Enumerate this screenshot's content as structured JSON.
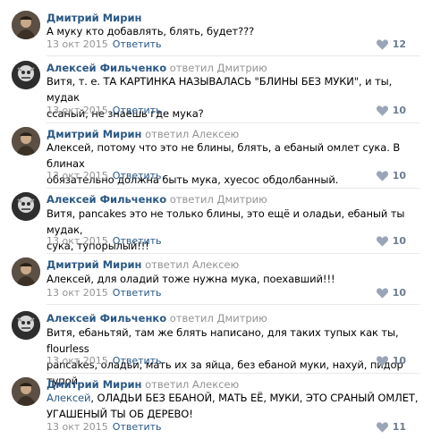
{
  "comments": [
    {
      "author": "Дмитрий Мирин",
      "reply_label": "",
      "reply_target": "",
      "mention": "",
      "text_lines": [
        "А муку кто добавлять, блять, будет???"
      ],
      "date": "13 окт 2015",
      "reply_link": "Ответить",
      "likes": "12",
      "avatar_icon": "dmitry-avatar"
    },
    {
      "author": "Алексей Фильченко",
      "reply_label": "ответил",
      "reply_target": "Дмитрию",
      "mention": "",
      "text_lines": [
        "Витя, т. е. ТА КАРТИНКА НАЗЫВАЛАСЬ \"БЛИНЫ БЕЗ МУКИ\", и ты, мудак",
        "ссаный, не знаешь где мука?"
      ],
      "date": "13 окт 2015",
      "reply_link": "Ответить",
      "likes": "10",
      "avatar_icon": "alexey-avatar"
    },
    {
      "author": "Дмитрий Мирин",
      "reply_label": "ответил",
      "reply_target": "Алексею",
      "mention": "",
      "text_lines": [
        "Алексей, потому что это не блины, блять, а ебаный омлет сука. В блинах",
        "обязательно должна быть мука, хуесос обдолбанный."
      ],
      "date": "13 окт 2015",
      "reply_link": "Ответить",
      "likes": "10",
      "avatar_icon": "dmitry-avatar"
    },
    {
      "author": "Алексей Фильченко",
      "reply_label": "ответил",
      "reply_target": "Дмитрию",
      "mention": "",
      "text_lines": [
        "Витя, pancakes это не только блины, это ещё и оладьи, ебаный ты мудак,",
        "сука, тупорылый!!!"
      ],
      "date": "13 окт 2015",
      "reply_link": "Ответить",
      "likes": "10",
      "avatar_icon": "alexey-avatar"
    },
    {
      "author": "Дмитрий Мирин",
      "reply_label": "ответил",
      "reply_target": "Алексею",
      "mention": "",
      "text_lines": [
        "Алексей, для оладий тоже нужна мука, поехавший!!!"
      ],
      "date": "13 окт 2015",
      "reply_link": "Ответить",
      "likes": "10",
      "avatar_icon": "dmitry-avatar"
    },
    {
      "author": "Алексей Фильченко",
      "reply_label": "ответил",
      "reply_target": "Дмитрию",
      "mention": "",
      "text_lines": [
        "Витя, ебаньтяй, там же блять написано, для таких тупых как ты, flourless",
        "pancakes, оладьи, мать их за яйца, без ебаной муки, нахуй, пидор тупой"
      ],
      "date": "13 окт 2015",
      "reply_link": "Ответить",
      "likes": "10",
      "avatar_icon": "alexey-avatar"
    },
    {
      "author": "Дмитрий Мирин",
      "reply_label": "ответил",
      "reply_target": "Алексею",
      "mention": "Алексей",
      "text_lines": [
        ", ОЛАДЬИ БЕЗ ЕБАНОЙ, МАТЬ ЕЁ, МУКИ, ЭТО СРАНЫЙ ОМЛЕТ,",
        "УГАШЕНЫЙ ТЫ ОБ ДЕРЕВО!"
      ],
      "date": "13 окт 2015",
      "reply_link": "Ответить",
      "likes": "11",
      "avatar_icon": "dmitry-avatar"
    }
  ],
  "colors": {
    "author_link": "#2a5885",
    "muted": "#939393",
    "like_count": "#6b7c8f",
    "heart": "#9aa6b6",
    "divider": "#e7e8ec"
  },
  "icons": {
    "like": "heart-icon"
  }
}
